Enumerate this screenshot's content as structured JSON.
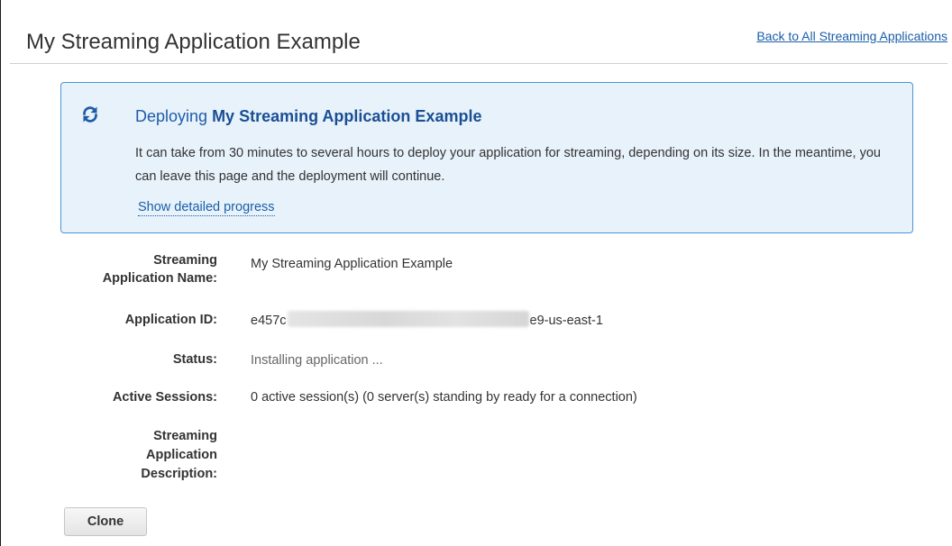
{
  "header": {
    "title": "My Streaming Application Example",
    "back_link": "Back to All Streaming Applications"
  },
  "deploy_notice": {
    "icon": "refresh-icon",
    "title_prefix": "Deploying ",
    "title_app": "My Streaming Application Example",
    "message": "It can take from 30 minutes to several hours to deploy your application for streaming, depending on its size. In the meantime, you can leave this page and the deployment will continue.",
    "progress_link": "Show detailed progress",
    "accent_color": "#1f5ca8",
    "background_color": "#e8f2fb",
    "border_color": "#4b95d6"
  },
  "details": {
    "name_label_line1": "Streaming",
    "name_label_line2": "Application Name:",
    "name_value": "My Streaming Application Example",
    "id_label": "Application ID:",
    "id_value_start": "e457c",
    "id_value_end": "e9-us-east-1",
    "status_label": "Status:",
    "status_value": "Installing application ...",
    "sessions_label": "Active Sessions:",
    "sessions_value": "0 active session(s) (0 server(s) standing by ready for a connection)",
    "description_label_line1": "Streaming",
    "description_label_line2": "Application",
    "description_label_line3": "Description:",
    "description_value": ""
  },
  "actions": {
    "clone_label": "Clone"
  }
}
